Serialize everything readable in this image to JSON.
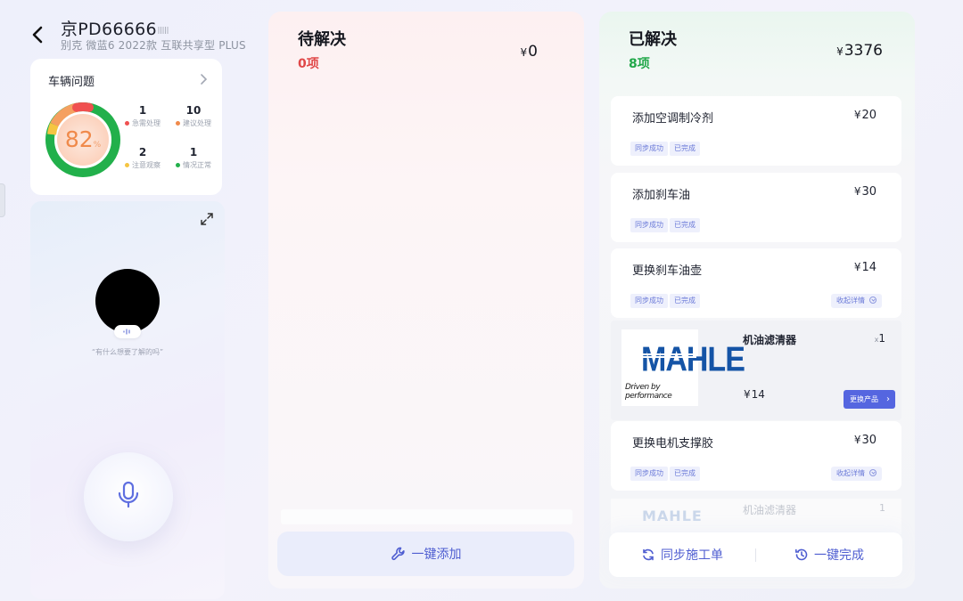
{
  "header": {
    "plate": "京PD66666",
    "plate_suffix": "",
    "model": "别克 微蓝6 2022款 互联共享型 PLUS"
  },
  "issues": {
    "title": "车辆问题",
    "score": "82",
    "stats": [
      {
        "num": "1",
        "label": "急需处理",
        "color": "#f05050"
      },
      {
        "num": "10",
        "label": "建议处理",
        "color": "#f08a4b"
      },
      {
        "num": "2",
        "label": "注意观察",
        "color": "#f5c542"
      },
      {
        "num": "1",
        "label": "情况正常",
        "color": "#22b04b"
      }
    ]
  },
  "assistant": {
    "prompt": "“有什么想要了解的吗”"
  },
  "pending": {
    "title": "待解决",
    "count": "0项",
    "total": "0",
    "add_label": "一键添加"
  },
  "resolved": {
    "title": "已解决",
    "count": "8项",
    "total": "3376",
    "items": [
      {
        "name": "添加空调制冷剂",
        "price": "20",
        "tags": [
          "同步成功",
          "已完成"
        ]
      },
      {
        "name": "添加刹车油",
        "price": "30",
        "tags": [
          "同步成功",
          "已完成"
        ]
      },
      {
        "name": "更换刹车油壶",
        "price": "14",
        "tags": [
          "同步成功",
          "已完成"
        ],
        "detail": "收起详情"
      },
      {
        "name": "更换电机支撑胶",
        "price": "30",
        "tags": [
          "同步成功",
          "已完成"
        ],
        "detail": "收起详情"
      }
    ],
    "product": {
      "brand": "MAHLE",
      "tagline": "Driven by performance",
      "name": "机油滤清器",
      "qty_prefix": "x",
      "qty": "1",
      "price": "14",
      "replace_label": "更换产品"
    },
    "ghost": {
      "name": "机油滤清器",
      "qty": "1"
    },
    "sync_label": "同步施工单",
    "complete_label": "一键完成"
  },
  "currency": "¥",
  "colors": {
    "accent": "#4f5ed1",
    "pending_red": "#e04848",
    "resolved_green": "#22a84a"
  }
}
